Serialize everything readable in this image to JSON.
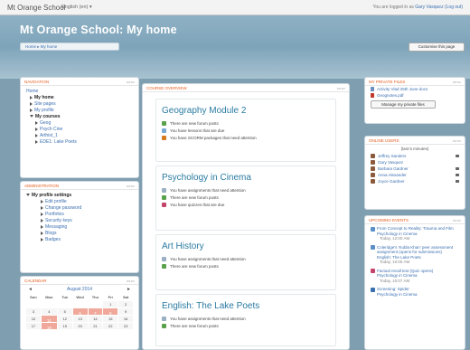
{
  "topbar": {
    "site_name": "Mt Orange School",
    "language": "English (en) ▾",
    "login_prefix": "You are logged in as",
    "user_name": "Gary Vasquez",
    "logout": "(Log out)"
  },
  "header": {
    "title": "Mt Orange School: My home",
    "breadcrumb": "Home ▸ My home",
    "customise_button": "Customise this page"
  },
  "navigation": {
    "title": "NAVIGATION",
    "items": {
      "home": "Home",
      "my_home": "My home",
      "site_pages": "Site pages",
      "my_profile": "My profile",
      "my_courses": "My courses",
      "c1": "Geog",
      "c2": "Psych Cine",
      "c3": "Arthist_1",
      "c4": "EDE1: Lake Poets"
    }
  },
  "administration": {
    "title": "ADMINISTRATION",
    "heading": "My profile settings",
    "items": [
      "Edit profile",
      "Change password",
      "Portfolios",
      "Security keys",
      "Messaging",
      "Blogs",
      "Badges"
    ]
  },
  "calendar": {
    "title": "CALENDAR",
    "month": "August 2014",
    "prev": "◄",
    "next": "►",
    "days": [
      "Sun",
      "Mon",
      "Tue",
      "Wed",
      "Thu",
      "Fri",
      "Sat"
    ],
    "row1": [
      "",
      "",
      "",
      "",
      "",
      "1",
      "2"
    ],
    "row2": [
      "3",
      "4",
      "5",
      "6",
      "7",
      "8",
      "9"
    ],
    "row3": [
      "10",
      "11",
      "12",
      "13",
      "14",
      "15",
      "16"
    ],
    "row4": [
      "17",
      "18",
      "19",
      "20",
      "21",
      "22",
      "23"
    ]
  },
  "course_overview": {
    "title": "COURSE OVERVIEW",
    "courses": [
      {
        "name": "Geography Module 2",
        "notices": [
          "There are new forum posts",
          "You have lessons that are due",
          "You have SCORM packages that need attention"
        ]
      },
      {
        "name": "Psychology in Cinema",
        "notices": [
          "You have assignments that need attention",
          "There are new forum posts",
          "You have quizzes that are due"
        ]
      },
      {
        "name": "Art History",
        "notices": [
          "You have assignments that need attention",
          "There are new forum posts"
        ]
      },
      {
        "name": "English: The Lake Poets",
        "notices": [
          "You have assignments that need attention",
          "There are new forum posts"
        ]
      }
    ]
  },
  "private_files": {
    "title": "MY PRIVATE FILES",
    "files": [
      "Activity Vlad 25th June docs",
      "Geognotes.pdf"
    ],
    "manage_button": "Manage my private files"
  },
  "online_users": {
    "title": "ONLINE USERS",
    "subtitle": "(last 5 minutes)",
    "users": [
      "Jeffrey Sanders",
      "Gary Vasquez",
      "Barbara Gardner",
      "Anna Alexander",
      "Joyce Gardner"
    ]
  },
  "upcoming_events": {
    "title": "UPCOMING EVENTS",
    "events": [
      {
        "title": "From Concept to Reality: Trauma and Film",
        "course": "Psychology in Cinema",
        "time": "Today, 12:00 AM"
      },
      {
        "title": "Coleridge's 'Kubla Khan' peer assessment assignment (opens for submissions)",
        "course": "English: The Lake Poets",
        "time": "Today, 10:05 AM"
      },
      {
        "title": "Factual recall test (Quiz opens)",
        "course": "Psychology in Cinema",
        "time": "Today, 10:07 AM"
      },
      {
        "title": "Screening: Spider",
        "course": "Psychology in Cinema",
        "time": ""
      }
    ]
  },
  "colors": {
    "accent": "#e55a1b",
    "link": "#3a6fb0",
    "course_title": "#2a7ba1"
  }
}
